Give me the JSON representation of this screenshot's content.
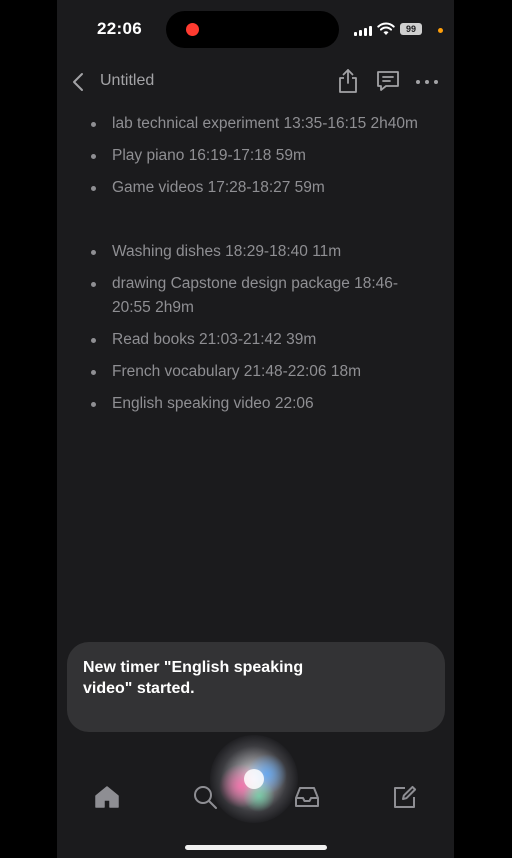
{
  "status_bar": {
    "time": "22:06",
    "battery": "99",
    "record_color": "#ff3b30",
    "orange_dot_color": "#ff9f0a"
  },
  "nav": {
    "back_icon": "chevron-left-icon",
    "title": "Untitled",
    "share_icon": "share-icon",
    "comment_icon": "comment-icon",
    "more_icon": "ellipsis-icon"
  },
  "note": {
    "items": [
      "lab technical experiment 13:35-16:15 2h40m",
      "Play piano 16:19-17:18 59m",
      "Game videos 17:28-18:27 59m",
      "Washing dishes 18:29-18:40 11m",
      "drawing Capstone design package 18:46-20:55 2h9m",
      "Read books 21:03-21:42 39m",
      "French vocabulary 21:48-22:06 18m",
      "English speaking video 22:06"
    ]
  },
  "siri": {
    "message": "New timer \"English speaking video\" started."
  },
  "tab_bar": {
    "icons": [
      "home-icon",
      "search-icon",
      "inbox-icon",
      "compose-icon"
    ]
  },
  "colors": {
    "background": "#1b1b1d",
    "text_muted": "#8f8f93",
    "toast_bg": "#333335"
  }
}
